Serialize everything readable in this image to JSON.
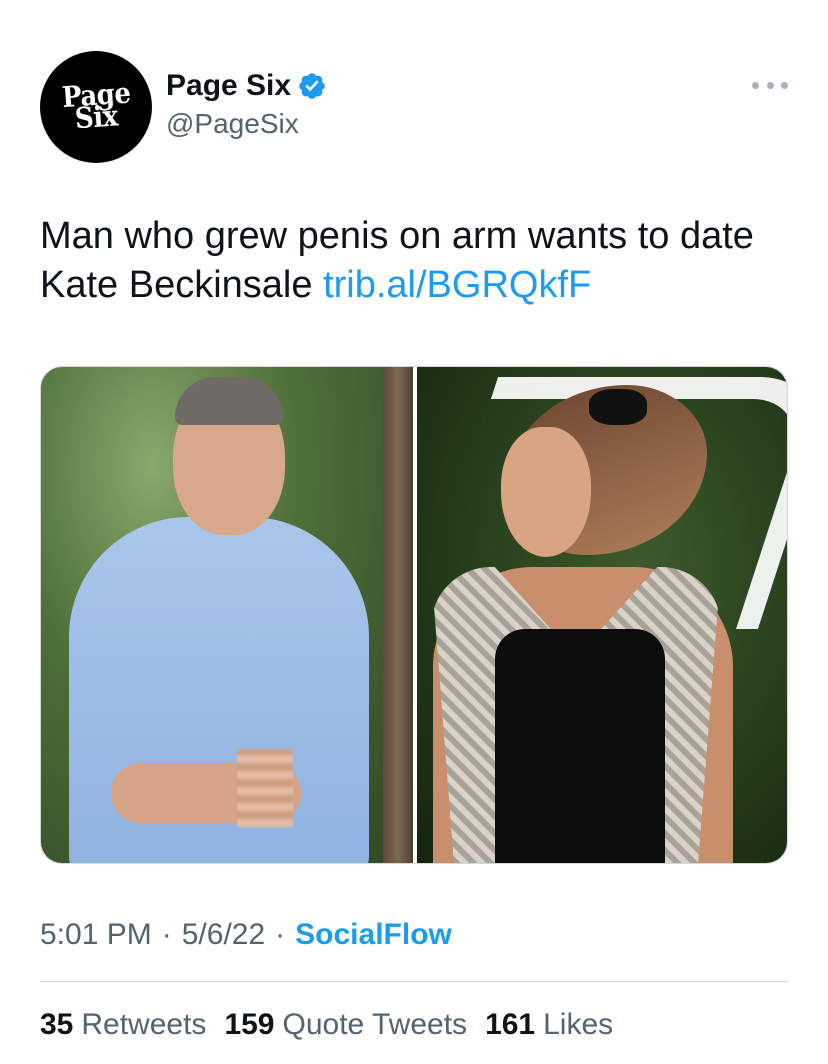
{
  "author": {
    "avatar_logo_line1": "Page",
    "avatar_logo_line2": "Six",
    "display_name": "Page Six",
    "verified_icon": "verified-badge-icon",
    "handle": "@PageSix"
  },
  "more_icon": "more-horizontal-icon",
  "tweet": {
    "text": "Man who grew penis on arm wants to date Kate Beckinsale ",
    "link": "trib.al/BGRQkfF"
  },
  "meta": {
    "time": "5:01 PM",
    "separator": "·",
    "date": "5/6/22",
    "source": "SocialFlow"
  },
  "stats": {
    "retweets_count": "35",
    "retweets_label": "Retweets",
    "quote_tweets_count": "159",
    "quote_tweets_label": "Quote Tweets",
    "likes_count": "161",
    "likes_label": "Likes"
  },
  "colors": {
    "link": "#1d9bf0",
    "secondary_text": "#536471",
    "primary_text": "#0f1419",
    "divider": "#cfd9de"
  }
}
